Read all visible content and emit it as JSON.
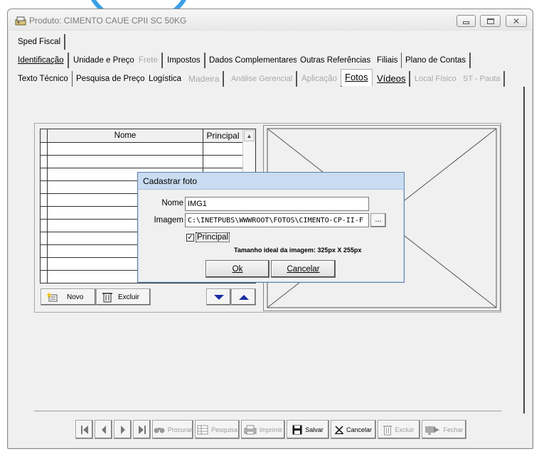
{
  "window": {
    "title": "Produto: CIMENTO CAUE CPII SC 50KG",
    "minimize": "minimize",
    "maximize": "maximize",
    "close": "close"
  },
  "tabs": {
    "row1": [
      {
        "label": "Sped Fiscal",
        "disabled": false
      }
    ],
    "row2": [
      {
        "label": "Identificação",
        "underline": "I",
        "disabled": false
      },
      {
        "label": "Unidade e Preço",
        "underline": "U",
        "disabled": false
      },
      {
        "label": "Frete",
        "disabled": true
      },
      {
        "label": "Impostos",
        "underline": "I",
        "disabled": false
      },
      {
        "label": "Dados Complementares",
        "underline": "D",
        "disabled": false
      },
      {
        "label": "Outras Referências",
        "underline": "O",
        "disabled": false
      },
      {
        "label": "Filiais",
        "underline": "F",
        "disabled": false
      },
      {
        "label": "Plano de Contas",
        "underline": "P",
        "disabled": false
      }
    ],
    "row3": [
      {
        "label": "Texto Técnico",
        "underline": "T",
        "disabled": false
      },
      {
        "label": "Pesquisa de Preço",
        "underline": "e",
        "disabled": false
      },
      {
        "label": "Logística",
        "disabled": false
      },
      {
        "label": "Madeira",
        "disabled": true
      },
      {
        "label": "Análise Gerencial",
        "disabled": true
      },
      {
        "label": "Aplicação",
        "underline": "A",
        "disabled": true
      },
      {
        "label": "Fotos",
        "underline": "F",
        "disabled": false,
        "active": true
      },
      {
        "label": "Vídeos",
        "underline": "V",
        "disabled": false
      },
      {
        "label": "Local Físico",
        "underline": "L",
        "disabled": true
      },
      {
        "label": "ST - Pauta",
        "disabled": true
      }
    ]
  },
  "grid": {
    "columns": [
      "Nome",
      "Principal"
    ],
    "rows": 11
  },
  "grid_buttons": {
    "novo": "Novo",
    "excluir": "Excluir"
  },
  "dialog": {
    "title": "Cadastrar foto",
    "nome_label": "Nome",
    "nome_value": "IMG1",
    "imagem_label": "Imagem",
    "imagem_value": "C:\\INETPUBS\\WWWROOT\\FOTOS\\CIMENTO-CP-II-F",
    "browse_label": "...",
    "principal_label": "Principal",
    "principal_checked": true,
    "check_glyph": "✓",
    "hint": "Tamanho ideal da imagem: 325px X 255px",
    "ok": "Ok",
    "cancel": "Cancelar"
  },
  "toolbar": {
    "procurar": "Procurar",
    "pesquisa": "Pesquisa",
    "imprimir": "Imprimir",
    "salvar": "Salvar",
    "cancelar": "Cancelar",
    "excluir": "Excluir",
    "fechar": "Fechar"
  },
  "colors": {
    "accent": "#1a2fa0",
    "dialog_title_bg": "#c9dcf1",
    "disabled_text": "#a8a8a8"
  }
}
